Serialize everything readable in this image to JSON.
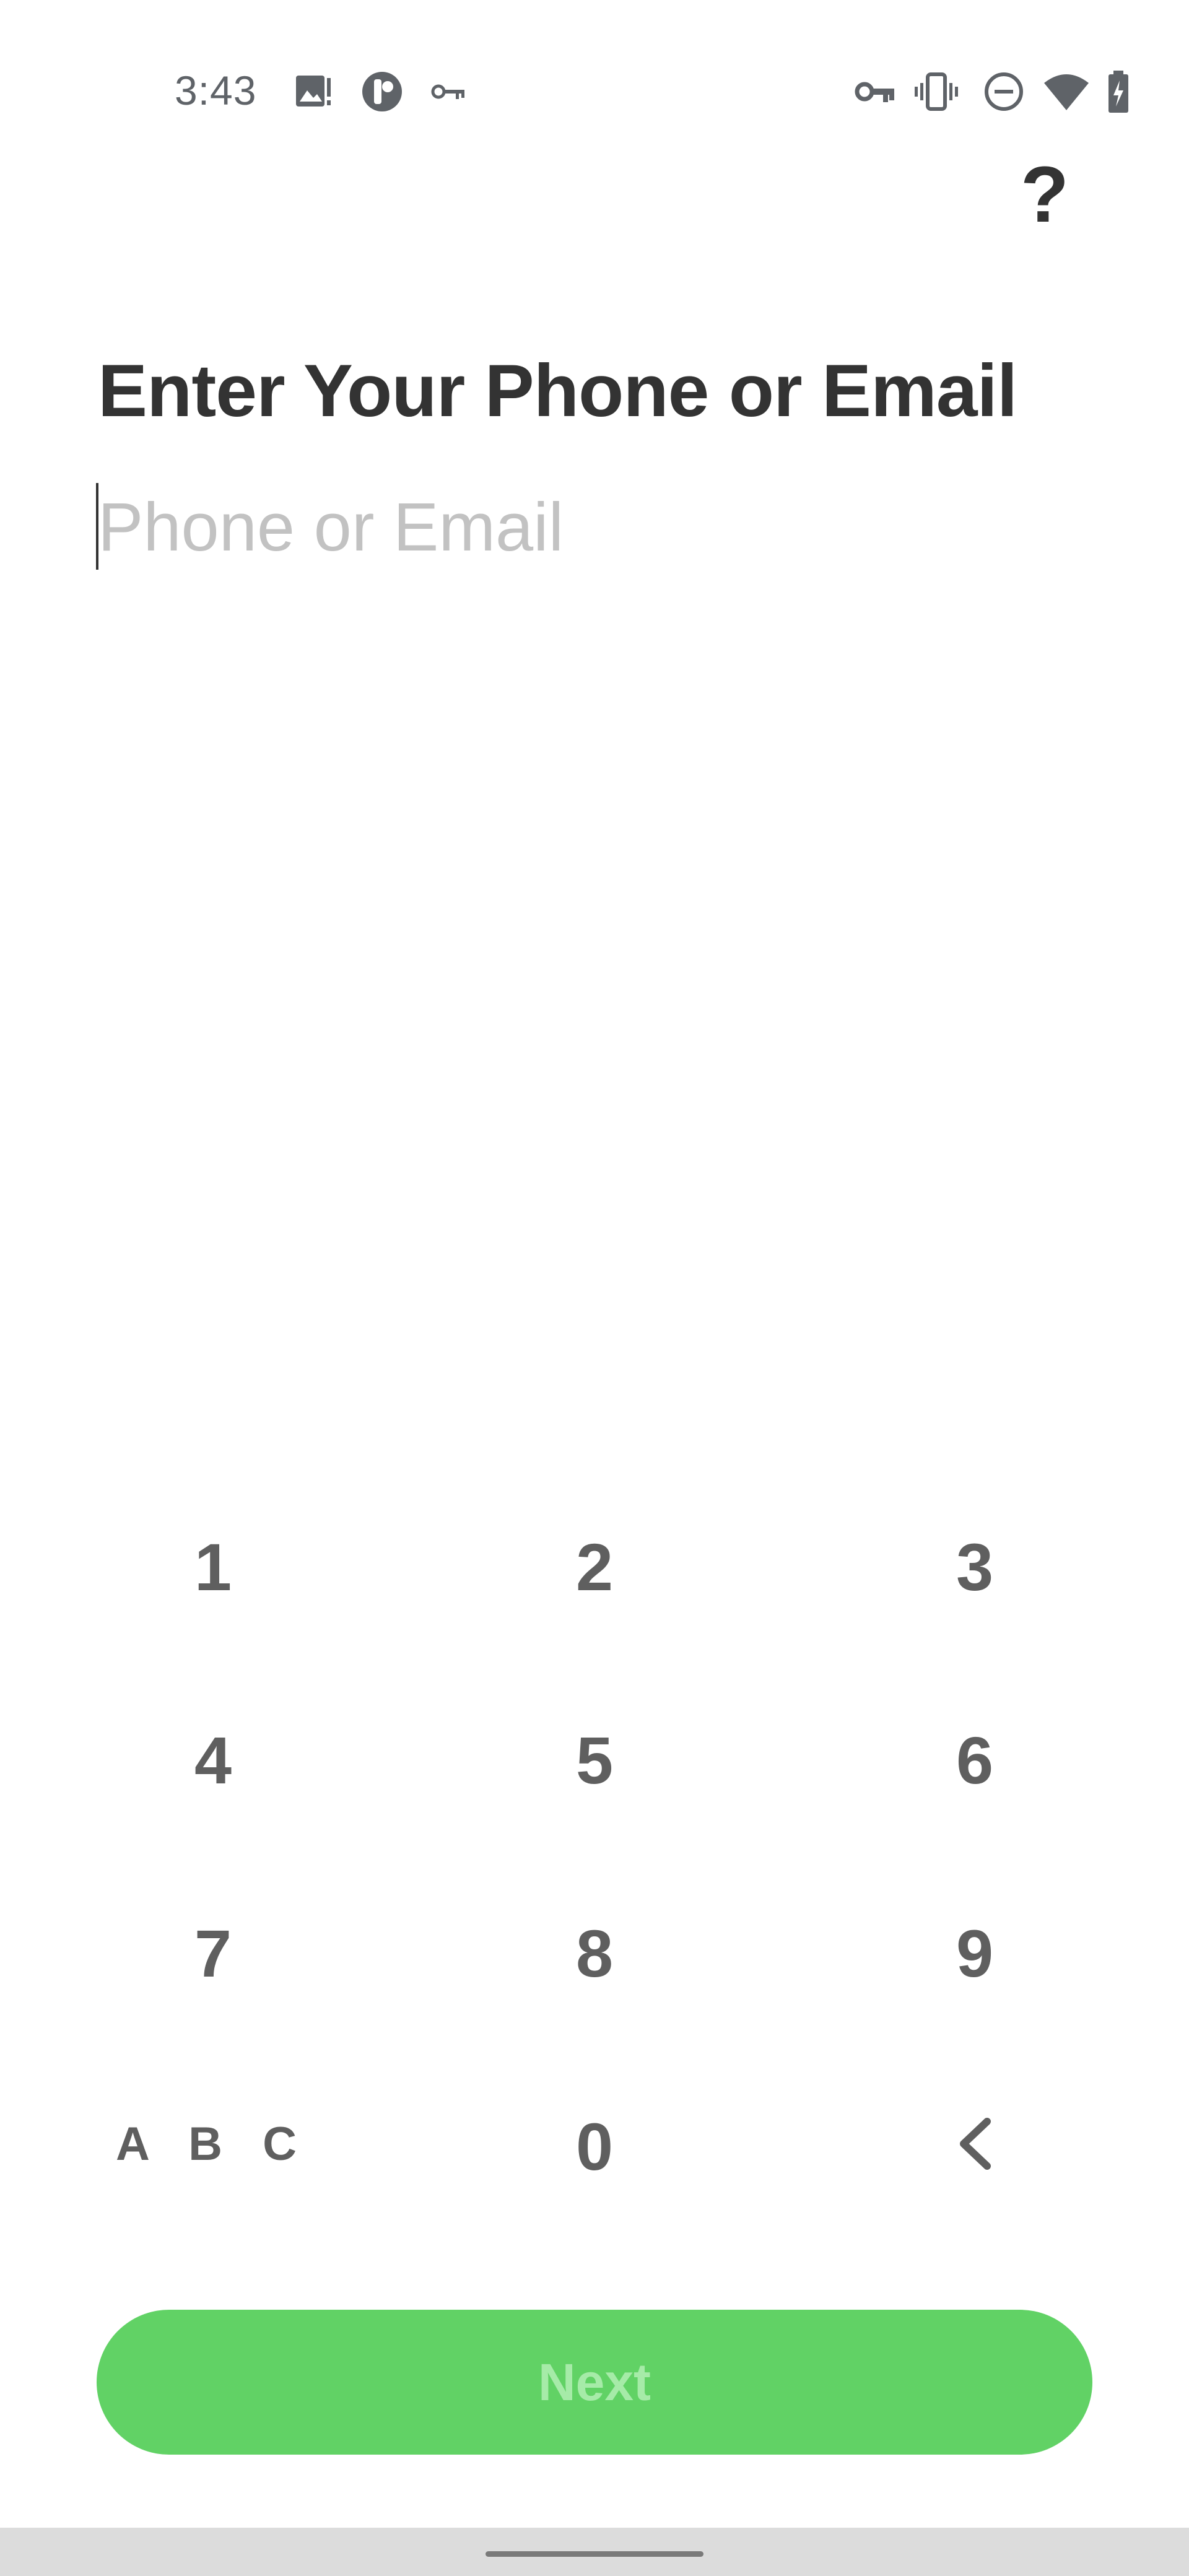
{
  "status_bar": {
    "time": "3:43",
    "left_icons": [
      "image-alert-icon",
      "app-icon",
      "key-icon"
    ],
    "right_icons": [
      "vpn-key-icon",
      "vibrate-icon",
      "do-not-disturb-icon",
      "wifi-icon",
      "battery-charging-icon"
    ]
  },
  "header": {
    "help_label": "?"
  },
  "page": {
    "title": "Enter Your Phone or Email",
    "input": {
      "value": "",
      "placeholder": "Phone or Email"
    }
  },
  "keypad": {
    "keys": [
      "1",
      "2",
      "3",
      "4",
      "5",
      "6",
      "7",
      "8",
      "9",
      "A B C",
      "0",
      "‹"
    ]
  },
  "next_button": {
    "label": "Next",
    "enabled": false
  },
  "colors": {
    "accent": "#61d265",
    "accent_text_disabled": "#a6eba8",
    "title": "#333333",
    "placeholder": "#c2c2c2",
    "key_text": "#5f5f5f"
  }
}
